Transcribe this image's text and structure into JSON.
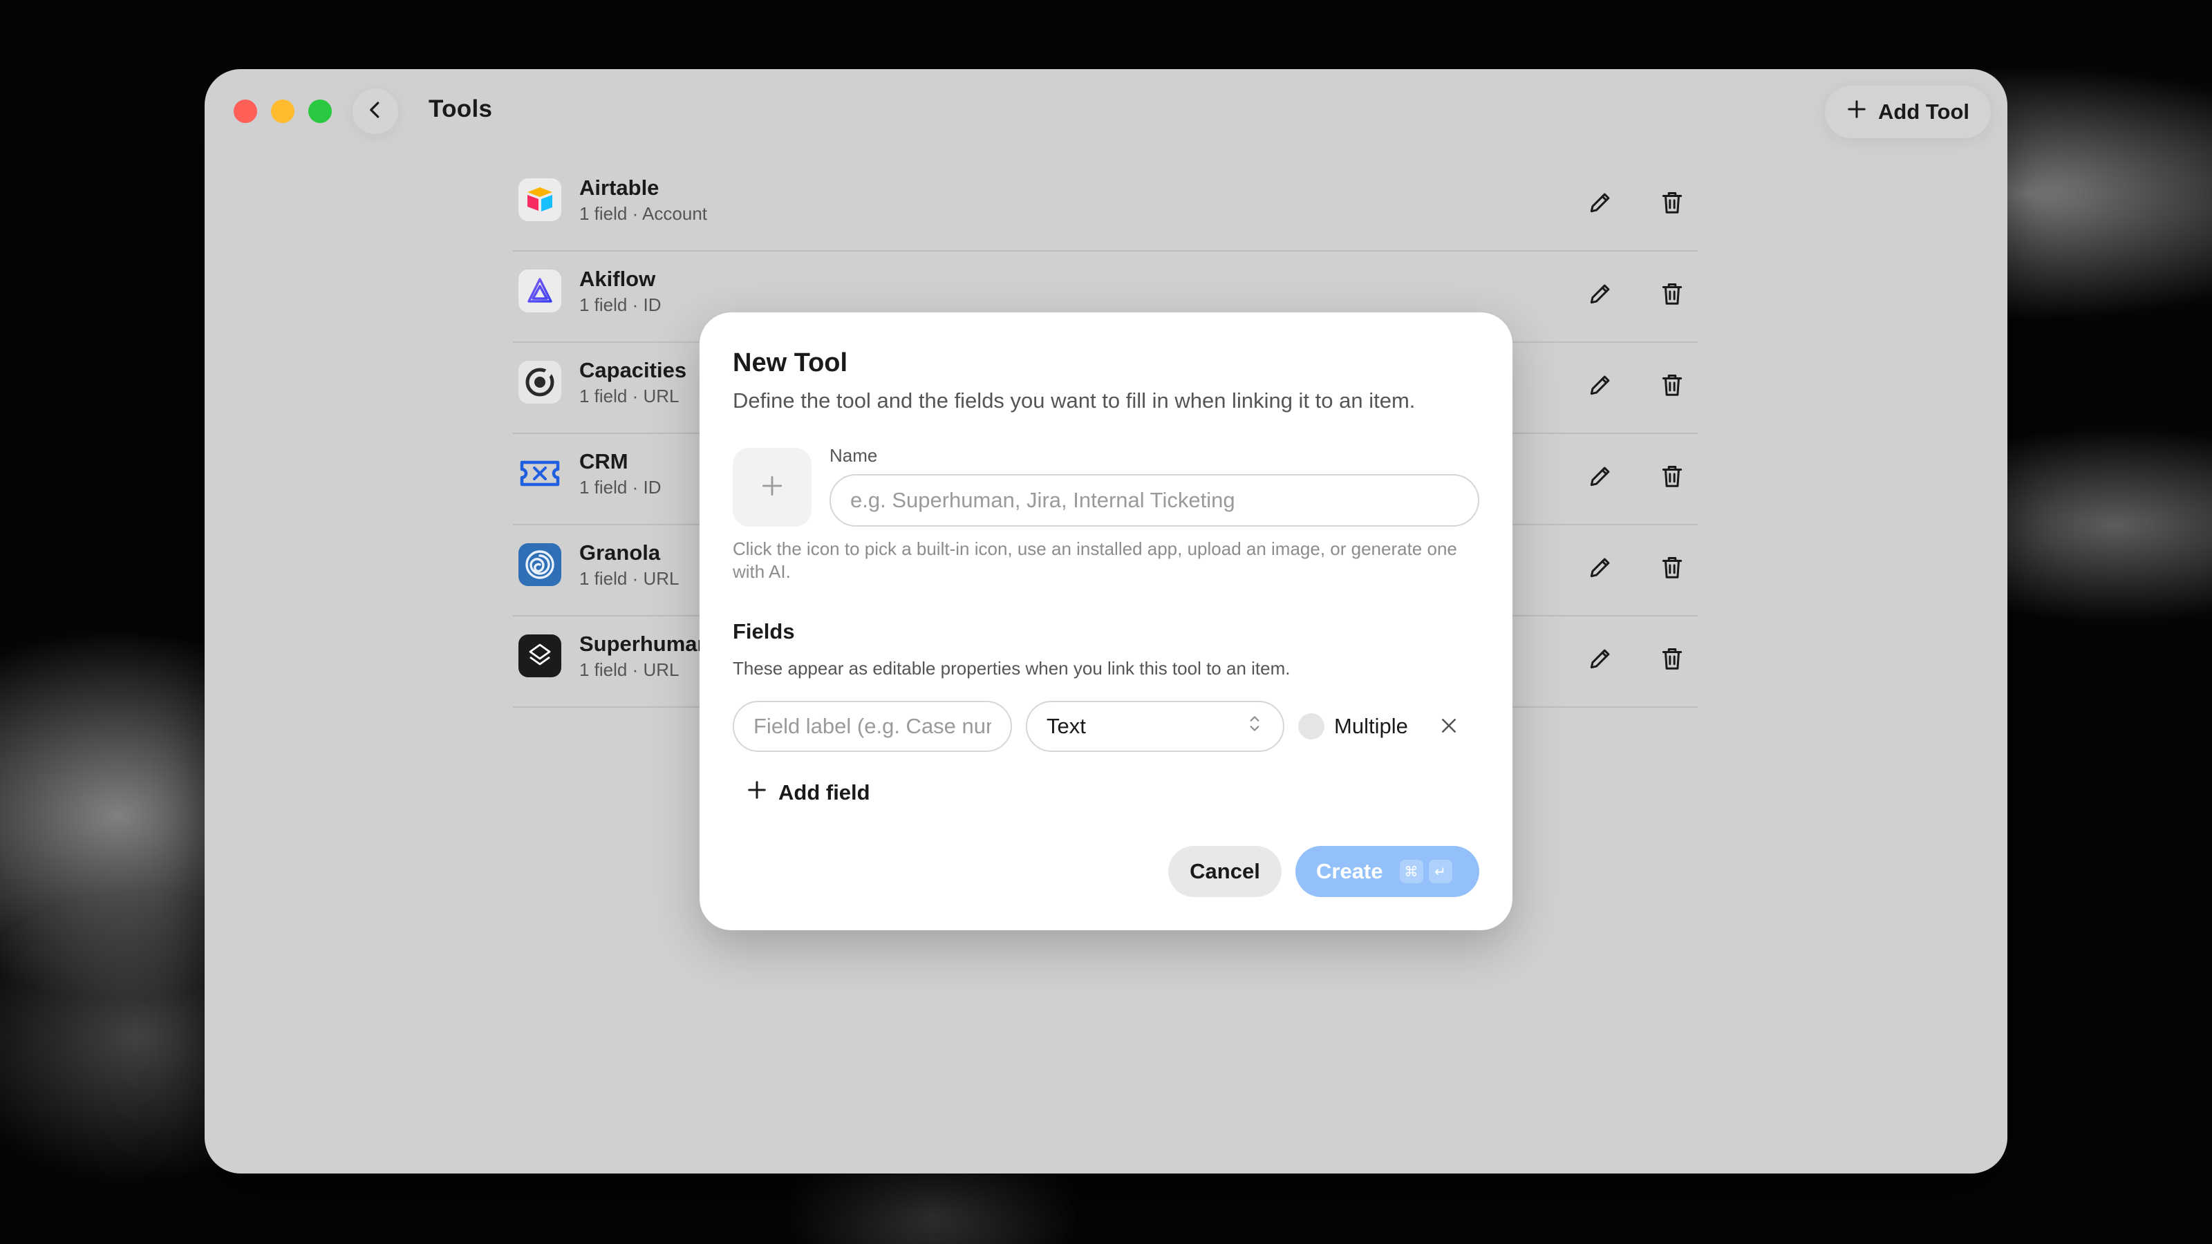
{
  "window": {
    "title": "Tools"
  },
  "toolbar": {
    "add_tool_label": "Add Tool"
  },
  "tools": [
    {
      "name": "Airtable",
      "meta": "1 field · Account",
      "icon": "airtable-icon"
    },
    {
      "name": "Akiflow",
      "meta": "1 field · ID",
      "icon": "akiflow-icon"
    },
    {
      "name": "Capacities",
      "meta": "1 field · URL",
      "icon": "capacities-icon"
    },
    {
      "name": "CRM",
      "meta": "1 field · ID",
      "icon": "ticket-icon"
    },
    {
      "name": "Granola",
      "meta": "1 field · URL",
      "icon": "granola-icon"
    },
    {
      "name": "Superhuman",
      "meta": "1 field · URL",
      "icon": "superhuman-icon"
    }
  ],
  "modal": {
    "title": "New Tool",
    "subtitle": "Define the tool and the fields you want to fill in when linking it to an item.",
    "name_label": "Name",
    "name_placeholder": "e.g. Superhuman, Jira, Internal Ticketing",
    "helper_text": "Click the icon to pick a built-in icon, use an installed app, upload an image, or generate one with AI.",
    "fields_title": "Fields",
    "fields_description": "These appear as editable properties when you link this tool to an item.",
    "field_label_placeholder": "Field label (e.g. Case number)",
    "field_type_value": "Text",
    "multiple_label": "Multiple",
    "add_field_label": "Add field",
    "cancel_label": "Cancel",
    "create_label": "Create",
    "create_shortcut": [
      "⌘",
      "↵"
    ]
  },
  "colors": {
    "accent": "#93c0fb",
    "window_bg": "#d0d0d0",
    "close": "#fe5f57",
    "minimize": "#febc2e",
    "maximize": "#28c840"
  }
}
